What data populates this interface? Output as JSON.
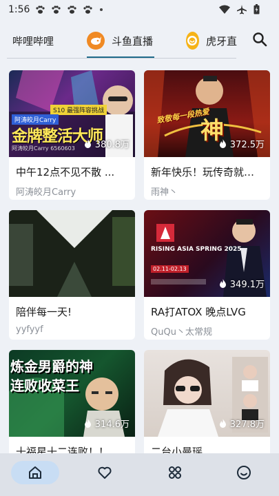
{
  "status_bar": {
    "time": "1:56"
  },
  "tabs": [
    {
      "label": "哔哩哔哩"
    },
    {
      "label": "斗鱼直播"
    },
    {
      "label": "虎牙直"
    }
  ],
  "thumb_texts": {
    "card0": {
      "banner": "S10 最强阵容挑战",
      "big": "金牌整活大师",
      "name": "阿涛皎月Carry",
      "sub": "阿涛皎月Carry 6560603"
    },
    "card1": {
      "big": "神",
      "slogan": "致敬每一段热爱"
    },
    "card3": {
      "event": "RISING ASIA SPRING 2025",
      "sub": "02.11-02.13"
    },
    "card4": {
      "line1": "炼金男爵的神",
      "line2": "连败收菜王"
    }
  },
  "cards": [
    {
      "viewers": "380.8万",
      "title": "中午12点不见不散 ...",
      "author": "阿涛皎月Carry"
    },
    {
      "viewers": "372.5万",
      "title": "新年快乐！玩传奇就…",
      "author": "雨神丶"
    },
    {
      "viewers": "",
      "title": "陪伴每一天!",
      "author": "yyfyyf"
    },
    {
      "viewers": "349.1万",
      "title": "RA打ATOX 晚点LVG",
      "author": "QuQu丶太常规"
    },
    {
      "viewers": "314.6万",
      "title": "十福星十二连败！！",
      "author": ""
    },
    {
      "viewers": "327.8万",
      "title": "二台小曼瑶",
      "author": ""
    }
  ],
  "colors": {
    "accent": "#1f6b8a",
    "nav_active": "#c8ddf4",
    "background": "#eef1f6"
  },
  "nav": [
    {
      "icon": "home-icon"
    },
    {
      "icon": "heart-icon"
    },
    {
      "icon": "apps-icon"
    },
    {
      "icon": "smile-icon"
    }
  ]
}
